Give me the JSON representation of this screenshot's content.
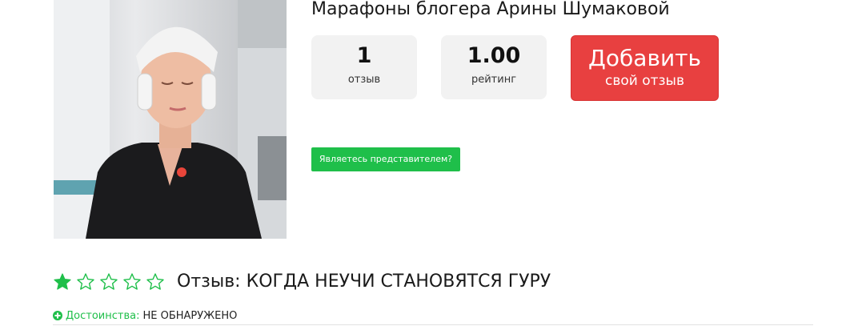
{
  "listing": {
    "title": "Марафоны блогера Арины Шумаковой",
    "photo_icon": "person-photo"
  },
  "stats": {
    "reviews_count": "1",
    "reviews_label": "отзыв",
    "rating_value": "1.00",
    "rating_label": "рейтинг"
  },
  "add_review": {
    "line1": "Добавить",
    "line2": "свой отзыв",
    "color": "#e84040"
  },
  "representative_button": {
    "label": "Являетесь представителем?",
    "color": "#1fbf4a"
  },
  "review": {
    "rating": 1,
    "max_rating": 5,
    "star_color": "#1fbf4a",
    "title": "Отзыв: КОГДА НЕУЧИ СТАНОВЯТСЯ ГУРУ",
    "pros_label": "Достоинства:",
    "pros_value": "НЕ ОБНАРУЖЕНО",
    "pros_icon": "plus-circle-icon"
  }
}
